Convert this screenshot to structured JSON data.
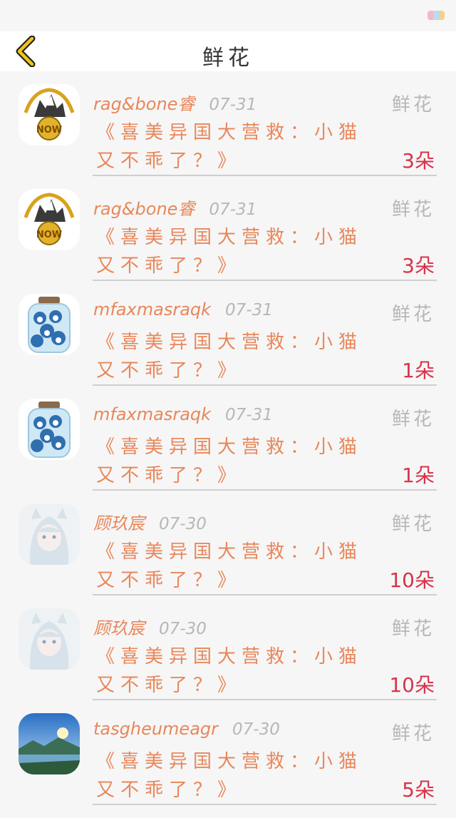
{
  "header": {
    "title": "鲜花"
  },
  "colors": {
    "accent": "#e8875a",
    "count": "#d8334a",
    "muted": "#b7b7b7",
    "back": "#f2c419"
  },
  "gifts": [
    {
      "avatar": "wolf-logo",
      "name": "rag&bone睿",
      "date": "07-31",
      "type": "鲜花",
      "title": "《喜美异国大营救：小猫又不乖了？》",
      "count": "3朵"
    },
    {
      "avatar": "wolf-logo",
      "name": "rag&bone睿",
      "date": "07-31",
      "type": "鲜花",
      "title": "《喜美异国大营救：小猫又不乖了？》",
      "count": "3朵"
    },
    {
      "avatar": "jar",
      "name": "mfaxmasraqk",
      "date": "07-31",
      "type": "鲜花",
      "title": "《喜美异国大营救：小猫又不乖了？》",
      "count": "1朵"
    },
    {
      "avatar": "jar",
      "name": "mfaxmasraqk",
      "date": "07-31",
      "type": "鲜花",
      "title": "《喜美异国大营救：小猫又不乖了？》",
      "count": "1朵"
    },
    {
      "avatar": "anime-girl",
      "name": "顾玖宸",
      "date": "07-30",
      "type": "鲜花",
      "title": "《喜美异国大营救：小猫又不乖了？》",
      "count": "10朵"
    },
    {
      "avatar": "anime-girl",
      "name": "顾玖宸",
      "date": "07-30",
      "type": "鲜花",
      "title": "《喜美异国大营救：小猫又不乖了？》",
      "count": "10朵"
    },
    {
      "avatar": "landscape",
      "name": "tasgheumeagr",
      "date": "07-30",
      "type": "鲜花",
      "title": "《喜美异国大营救：小猫又不乖了？》",
      "count": "5朵"
    }
  ]
}
